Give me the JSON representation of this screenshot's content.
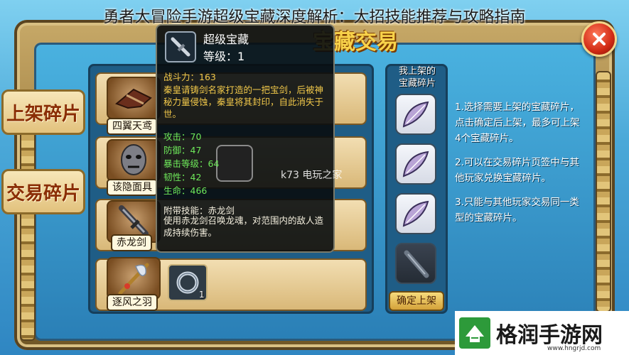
{
  "page_title": "勇者大冒险手游超级宝藏深度解析：大招技能推荐与攻略指南",
  "banner_text": "宝藏交易",
  "side_tabs": [
    {
      "label": "上架碎片"
    },
    {
      "label": "交易碎片"
    }
  ],
  "items": [
    {
      "label": "四翼天鸢",
      "icon": "wing-glider-icon"
    },
    {
      "label": "该隐面具",
      "icon": "mask-icon"
    },
    {
      "label": "赤龙剑",
      "icon": "sword-icon"
    },
    {
      "label": "逐风之羽",
      "icon": "feather-staff-icon"
    }
  ],
  "ring_slot": {
    "icon": "ring-icon",
    "count": "1"
  },
  "shelf": {
    "title_line1": "我上架的",
    "title_line2": "宝藏碎片",
    "confirm_label": "确定上架"
  },
  "instructions": [
    "1.选择需要上架的宝藏碎片，点击确定后上架，最多可上架4个宝藏碎片。",
    "2.可以在交易碎片页签中与其他玩家兑换宝藏碎片。",
    "3.只能与其他玩家交易同一类型的宝藏碎片。"
  ],
  "tooltip": {
    "name": "超级宝藏",
    "level": "等级：1",
    "power": "战斗力：163",
    "description": "秦皇请铸剑名家打造的一把宝剑，后被神秘力量侵蚀，秦皇将其封印，自此消失于世。",
    "stats": [
      "攻击：70",
      "防御：47",
      "暴击等级：64",
      "韧性：42",
      "生命：466"
    ],
    "skill_title": "附带技能：赤龙剑",
    "skill_description": "使用赤龙剑召唤龙魂，对范围内的敌人造成持续伤害。"
  },
  "watermark": "k73 电玩之家",
  "brand": {
    "name": "格润手游网",
    "url": "www.hngrjd.com"
  },
  "colors": {
    "tab_text": "#8a2d05",
    "tooltip_gold": "#f2c84a",
    "tooltip_green": "#6ee85a",
    "close_red": "#d12a14"
  }
}
